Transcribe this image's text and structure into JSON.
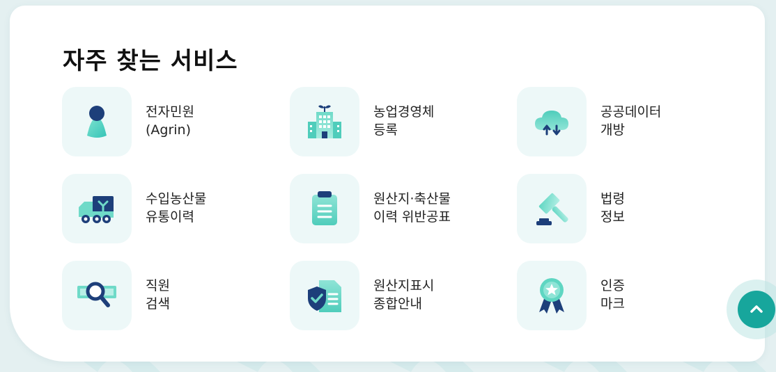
{
  "section": {
    "title": "자주 찾는 서비스"
  },
  "services": [
    {
      "line1": "전자민원",
      "line2": "(Agrin)",
      "icon": "person-icon"
    },
    {
      "line1": "농업경영체",
      "line2": "등록",
      "icon": "building-sprout-icon"
    },
    {
      "line1": "공공데이터",
      "line2": "개방",
      "icon": "cloud-transfer-icon"
    },
    {
      "line1": "수입농산물",
      "line2": "유통이력",
      "icon": "delivery-truck-icon"
    },
    {
      "line1": "원산지·축산물",
      "line2": "이력 위반공표",
      "icon": "clipboard-icon"
    },
    {
      "line1": "법령",
      "line2": "정보",
      "icon": "gavel-icon"
    },
    {
      "line1": "직원",
      "line2": "검색",
      "icon": "magnifier-icon"
    },
    {
      "line1": "원산지표시",
      "line2": "종합안내",
      "icon": "shield-document-icon"
    },
    {
      "line1": "인증",
      "line2": "마크",
      "icon": "award-ribbon-icon"
    }
  ],
  "colors": {
    "accent": "#17a69c",
    "navy": "#1d3f7a",
    "mint": "#5fd6c2",
    "tile_bg": "#edf8f8"
  },
  "scroll_top": {
    "icon": "chevron-up-icon"
  }
}
